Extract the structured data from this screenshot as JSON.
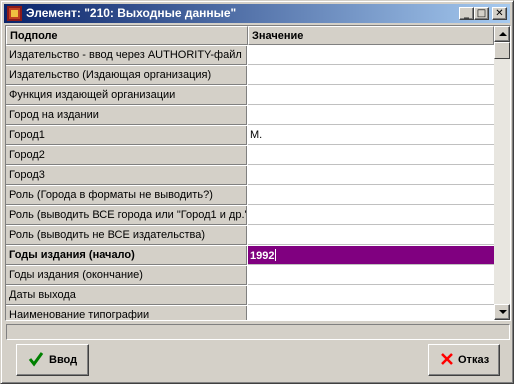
{
  "window": {
    "title": "Элемент: \"210: Выходные данные\"",
    "controls": {
      "minimize": "_",
      "maximize": "□",
      "close": "✕"
    }
  },
  "grid": {
    "columns": {
      "field": "Подполе",
      "value": "Значение"
    },
    "rows": [
      {
        "field": "Издательство - ввод через AUTHORITY-файл",
        "value": ""
      },
      {
        "field": "Издательство (Издающая организация)",
        "value": ""
      },
      {
        "field": "Функция издающей организации",
        "value": ""
      },
      {
        "field": "Город на издании",
        "value": ""
      },
      {
        "field": "Город1",
        "value": "М."
      },
      {
        "field": "Город2",
        "value": ""
      },
      {
        "field": "Город3",
        "value": ""
      },
      {
        "field": "Роль (Города в форматы не выводить?)",
        "value": ""
      },
      {
        "field": "Роль (выводить ВСЕ города или \"Город1 и др.\"",
        "value": ""
      },
      {
        "field": "Роль (выводить не ВСЕ издательства)",
        "value": ""
      },
      {
        "field": "Годы издания (начало)",
        "value": "1992",
        "selected": true
      },
      {
        "field": "Годы издания (окончание)",
        "value": ""
      },
      {
        "field": "Даты выхода",
        "value": ""
      },
      {
        "field": "Наименование типографии",
        "value": ""
      }
    ],
    "selected_color": "#800080"
  },
  "status": {
    "text": ""
  },
  "buttons": {
    "ok": {
      "label": "Ввод",
      "icon": "checkmark-icon",
      "color": "#008000"
    },
    "cancel": {
      "label": "Отказ",
      "icon": "cross-icon",
      "color": "#ff0000"
    }
  }
}
